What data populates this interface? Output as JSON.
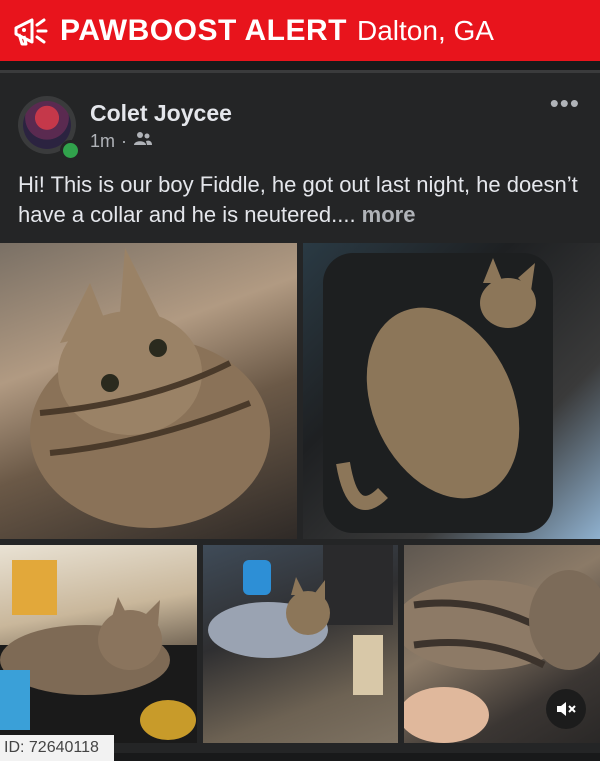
{
  "banner": {
    "brand": "PAWBOOST ALERT",
    "location": "Dalton, GA",
    "color": "#e8141c"
  },
  "post": {
    "author": "Colet Joycee",
    "time": "1m",
    "separator": "·",
    "audience_icon": "friends-icon",
    "text": "Hi! This is our boy Fiddle, he got out last night, he doesn’t have a collar and he is neutered.... ",
    "more_label": "more"
  },
  "photos": [
    {
      "name": "tabby cat held in arms"
    },
    {
      "name": "tabby cat sleeping on black cushion"
    },
    {
      "name": "tabby cat lying on table"
    },
    {
      "name": "tabby cat in sweater on floor"
    },
    {
      "name": "tabby cat close-up"
    }
  ],
  "footer": {
    "id_label": "ID: 72640118"
  }
}
